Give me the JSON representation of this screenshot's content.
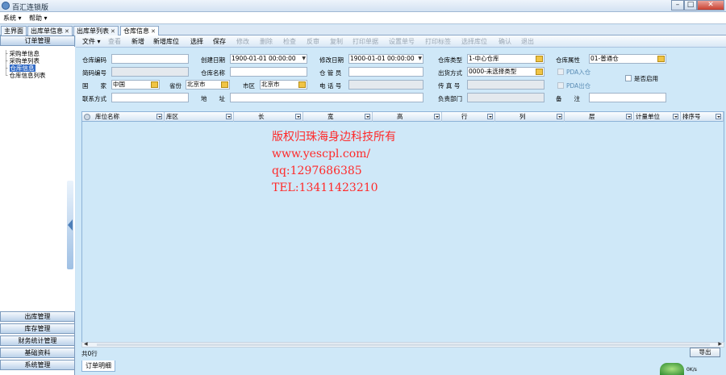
{
  "window": {
    "title": "百汇连锁版"
  },
  "menubar": {
    "items": [
      "系统 ▾",
      "帮助 ▾"
    ]
  },
  "tabs": [
    {
      "label": "主界面",
      "closable": false,
      "active": false
    },
    {
      "label": "出库单信息",
      "closable": true,
      "active": false
    },
    {
      "label": "出库单列表",
      "closable": true,
      "active": false
    },
    {
      "label": "仓库信息",
      "closable": true,
      "active": true
    }
  ],
  "sidebar": {
    "top_section": "订单管理",
    "tree": [
      {
        "label": "采购单信息",
        "selected": false
      },
      {
        "label": "采购单列表",
        "selected": false
      },
      {
        "label": "仓库信息",
        "selected": true
      },
      {
        "label": "仓库信息列表",
        "selected": false
      }
    ],
    "bottom_sections": [
      "出库管理",
      "库存管理",
      "财务统计管理",
      "基础资料",
      "系统管理"
    ]
  },
  "toolbar": {
    "items": [
      {
        "label": "文件 ▾",
        "enabled": true
      },
      {
        "label": "查看",
        "enabled": false
      },
      {
        "label": "新增",
        "enabled": true
      },
      {
        "label": "新增库位",
        "enabled": true
      },
      {
        "label": "选择",
        "enabled": true
      },
      {
        "label": "保存",
        "enabled": true
      },
      {
        "label": "修改",
        "enabled": false
      },
      {
        "label": "删除",
        "enabled": false
      },
      {
        "label": "检查",
        "enabled": false
      },
      {
        "label": "反审",
        "enabled": false
      },
      {
        "label": "复制",
        "enabled": false
      },
      {
        "label": "打印单据",
        "enabled": false
      },
      {
        "label": "设置单号",
        "enabled": false
      },
      {
        "label": "打印标签",
        "enabled": false
      },
      {
        "label": "选择库位",
        "enabled": false
      },
      {
        "label": "确认",
        "enabled": false
      },
      {
        "label": "退出",
        "enabled": false
      }
    ]
  },
  "form": {
    "doc_no": {
      "label": "仓库编码",
      "value": ""
    },
    "create_date": {
      "label": "创建日期",
      "value": "1900-01-01 00:00:00"
    },
    "modify_date": {
      "label": "修改日期",
      "value": "1900-01-01 00:00:00"
    },
    "warehouse_type": {
      "label": "仓库类型",
      "value": "1-中心仓库"
    },
    "warehouse_attr": {
      "label": "仓库属性",
      "value": "01-普通仓"
    },
    "short_code": {
      "label": "简码编号",
      "value": ""
    },
    "warehouse_name": {
      "label": "仓库名称",
      "value": ""
    },
    "keeper": {
      "label": "仓 管 员",
      "value": ""
    },
    "unit": {
      "label": "出货方式",
      "value": "0000-未选择类型"
    },
    "pda_in": {
      "label": "PDA入仓"
    },
    "pda_out": {
      "label": "PDA出仓"
    },
    "enabled": {
      "label": "是否启用"
    },
    "country": {
      "label": "国　　家",
      "value": "中国"
    },
    "province": {
      "label": "省份",
      "value": "北京市"
    },
    "city": {
      "label": "市区",
      "value": "北京市"
    },
    "phone": {
      "label": "电 话 号",
      "value": ""
    },
    "handset": {
      "label": "传 真 号",
      "value": ""
    },
    "contact": {
      "label": "联系方式",
      "value": ""
    },
    "address": {
      "label": "地　　址",
      "value": ""
    },
    "dept": {
      "label": "负责部门",
      "value": ""
    },
    "remark": {
      "label": "备　　注",
      "value": ""
    }
  },
  "grid": {
    "columns": [
      "库位名称",
      "库区",
      "长",
      "宽",
      "高",
      "行",
      "列",
      "层",
      "计量单位",
      "排序号"
    ]
  },
  "status": {
    "row_count": "共0行",
    "export_label": "导出"
  },
  "bottom_tab": {
    "label": "订单明细"
  },
  "watermark": {
    "lines": [
      "版权归珠海身边科技所有",
      "www.yescpl.com/",
      "qq:1297686385",
      "TEL:13411423210"
    ]
  },
  "tray": {
    "badge": "",
    "text": "0K/s"
  }
}
